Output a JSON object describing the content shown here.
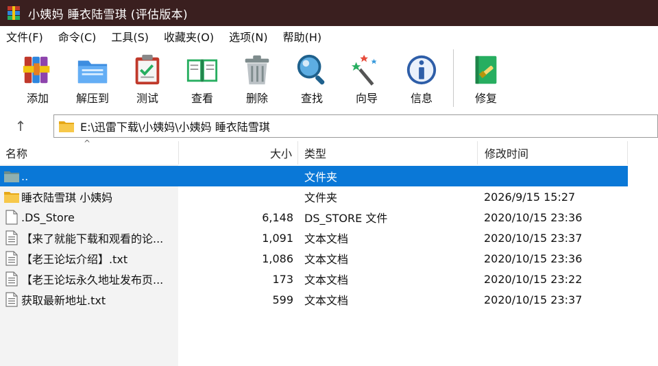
{
  "window": {
    "title": "小姨妈 睡衣陆雪琪 (评估版本)"
  },
  "menu": [
    "文件(F)",
    "命令(C)",
    "工具(S)",
    "收藏夹(O)",
    "选项(N)",
    "帮助(H)"
  ],
  "toolbar": {
    "add": "添加",
    "extract": "解压到",
    "test": "测试",
    "view": "查看",
    "delete": "删除",
    "find": "查找",
    "wizard": "向导",
    "info": "信息",
    "repair": "修复"
  },
  "address": {
    "path": "E:\\迅雷下载\\小姨妈\\小姨妈 睡衣陆雪琪"
  },
  "columns": {
    "name": "名称",
    "size": "大小",
    "type": "类型",
    "modified": "修改时间"
  },
  "rows": [
    {
      "name": "..",
      "size": "",
      "type": "文件夹",
      "modified": "",
      "icon": "folder-up-icon"
    },
    {
      "name": "睡衣陆雪琪 小姨妈",
      "size": "",
      "type": "文件夹",
      "modified": "2026/9/15 15:27",
      "icon": "folder-icon"
    },
    {
      "name": ".DS_Store",
      "size": "6,148",
      "type": "DS_STORE 文件",
      "modified": "2020/10/15 23:36",
      "icon": "file-icon"
    },
    {
      "name": "【来了就能下载和观看的论...",
      "size": "1,091",
      "type": "文本文档",
      "modified": "2020/10/15 23:37",
      "icon": "text-file-icon"
    },
    {
      "name": "【老王论坛介绍】.txt",
      "size": "1,086",
      "type": "文本文档",
      "modified": "2020/10/15 23:36",
      "icon": "text-file-icon"
    },
    {
      "name": "【老王论坛永久地址发布页...",
      "size": "173",
      "type": "文本文档",
      "modified": "2020/10/15 23:22",
      "icon": "text-file-icon"
    },
    {
      "name": "获取最新地址.txt",
      "size": "599",
      "type": "文本文档",
      "modified": "2020/10/15 23:37",
      "icon": "text-file-icon"
    }
  ],
  "colors": {
    "titlebar": "#3a1f1f",
    "selection": "#0a78d7"
  }
}
